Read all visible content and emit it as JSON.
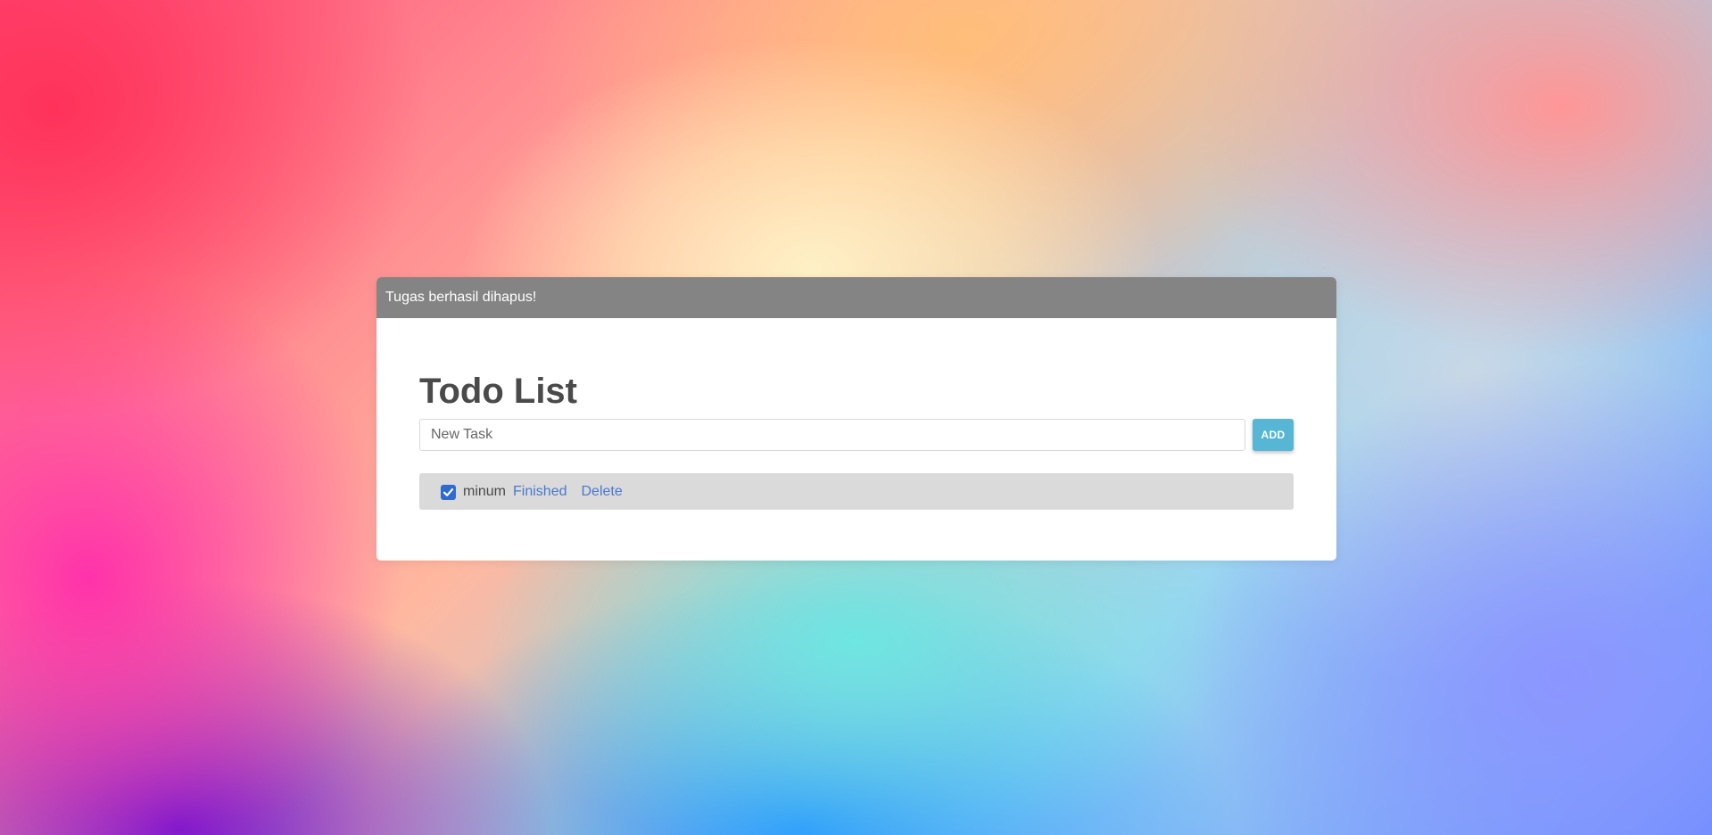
{
  "alert": {
    "message": "Tugas berhasil dihapus!"
  },
  "page": {
    "title": "Todo List"
  },
  "form": {
    "input_placeholder": "New Task",
    "input_value": "",
    "add_label": "ADD"
  },
  "tasks": [
    {
      "text": "minum",
      "checked": true,
      "finished_label": "Finished",
      "delete_label": "Delete"
    }
  ],
  "icons": {
    "checkbox": "check-icon"
  },
  "colors": {
    "alert_bg": "#848484",
    "add_button": "#56b6d4",
    "link": "#4a78cf",
    "checkbox": "#2f6ad0",
    "task_row_bg": "#dadada"
  }
}
